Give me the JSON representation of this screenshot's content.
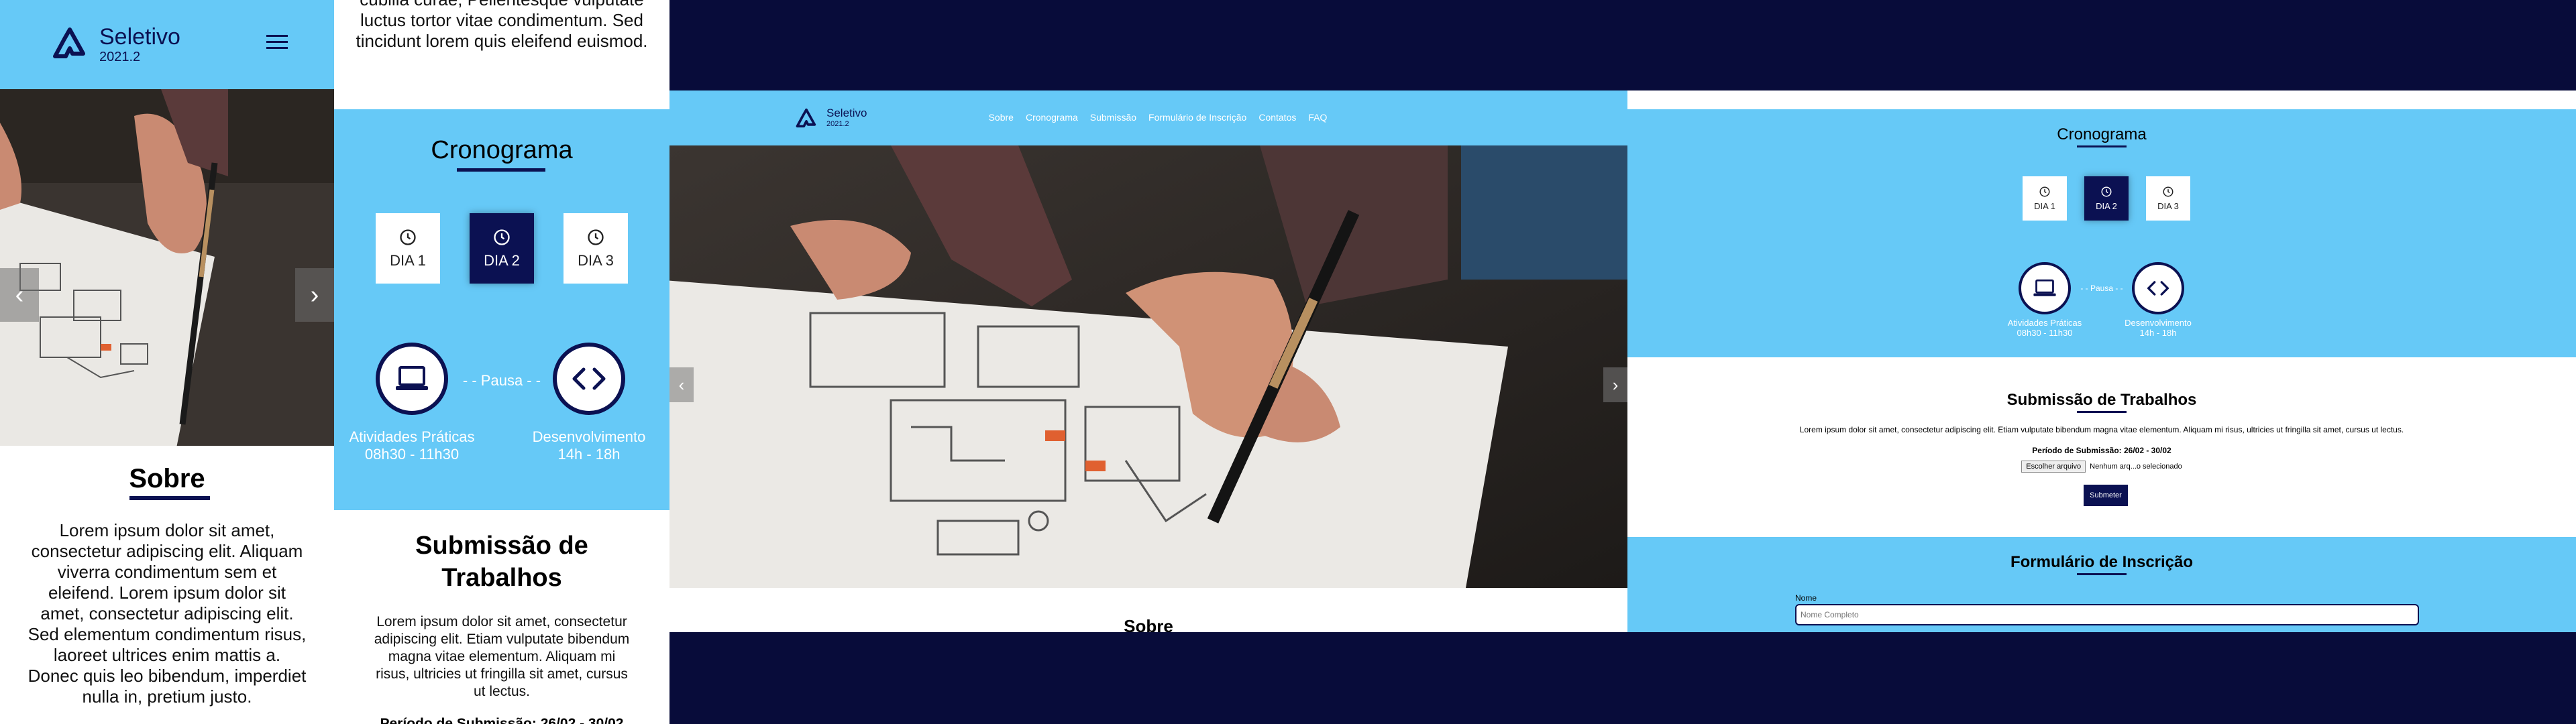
{
  "brand": {
    "name": "Seletivo",
    "year": "2021.2"
  },
  "nav": [
    "Sobre",
    "Cronograma",
    "Submissão",
    "Formulário de Inscrição",
    "Contatos",
    "FAQ"
  ],
  "sobre": {
    "title": "Sobre",
    "text": "Lorem ipsum dolor sit amet, consectetur adipiscing elit. Aliquam viverra condimentum sem et eleifend. Lorem ipsum dolor sit amet, consectetur adipiscing elit. Sed elementum condimentum risus, laoreet ultrices enim mattis a. Donec quis leo bibendum, imperdiet nulla in, pretium justo.",
    "text_tail": "cubilia curae; Pellentesque vulputate luctus tortor vitae condimentum. Sed tincidunt lorem quis eleifend euismod."
  },
  "cronograma": {
    "title": "Cronograma",
    "days": [
      "DIA 1",
      "DIA 2",
      "DIA 3"
    ],
    "active_day": "DIA 2",
    "pausa": "- - Pausa - -",
    "activities": [
      {
        "name": "Atividades Práticas",
        "time": "08h30 - 11h30",
        "icon": "laptop-icon"
      },
      {
        "name": "Desenvolvimento",
        "time": "14h - 18h",
        "icon": "code-icon"
      }
    ]
  },
  "submissao": {
    "title_mobile": "Submissão de Trabalhos",
    "title": "Submissão de Trabalhos",
    "text_mobile": "Lorem ipsum dolor sit amet, consectetur adipiscing elit. Etiam vulputate bibendum magna vitae elementum. Aliquam mi risus, ultricies ut fringilla sit amet, cursus ut lectus.",
    "text": "Lorem ipsum dolor sit amet, consectetur adipiscing elit. Etiam vulputate bibendum magna vitae elementum. Aliquam mi risus, ultricies ut fringilla sit amet, cursus ut lectus.",
    "periodo": "Período de Submissão: 26/02 - 30/02",
    "file_button": "Escolher arquivo",
    "file_status": "Nenhum arq...o selecionado",
    "submit": "Submeter"
  },
  "formulario": {
    "title": "Formulário de Inscrição",
    "name_label": "Nome",
    "name_placeholder": "Nome Completo"
  },
  "peek_title": "Sobre",
  "colors": {
    "accent": "#66c9f7",
    "navy": "#0b1152",
    "background": "#080c3a"
  }
}
